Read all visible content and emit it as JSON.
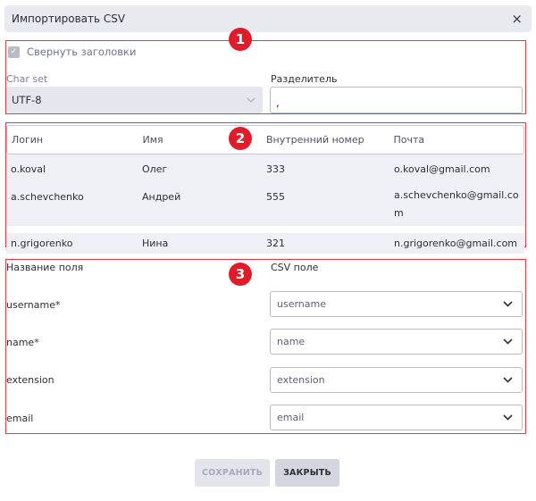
{
  "dialog": {
    "title": "Импортировать CSV",
    "close_glyph": "×"
  },
  "badges": [
    "1",
    "2",
    "3"
  ],
  "settings": {
    "collapse_headers_label": "Свернуть заголовки",
    "collapse_headers_checked": true,
    "charset_label": "Char set",
    "charset_value": "UTF-8",
    "separator_label": "Разделитель",
    "separator_value": ","
  },
  "preview": {
    "headers": [
      "Логин",
      "Имя",
      "Внутренний номер",
      "Почта"
    ],
    "rows": [
      [
        "o.koval",
        "Олег",
        "333",
        "o.koval@gmail.com"
      ],
      [
        "a.schevchenko",
        "Андрей",
        "555",
        "a.schevchenko@gmail.com"
      ],
      [
        "n.grigorenko",
        "Нина",
        "321",
        "n.grigorenko@gmail.com"
      ]
    ]
  },
  "mapping": {
    "field_header": "Название поля",
    "csv_header": "CSV поле",
    "fields": [
      {
        "label": "username*",
        "value": "username"
      },
      {
        "label": "name*",
        "value": "name"
      },
      {
        "label": "extension",
        "value": "extension"
      },
      {
        "label": "email",
        "value": "email"
      }
    ]
  },
  "buttons": {
    "save": "СОХРАНИТЬ",
    "close": "ЗАКРЫТЬ"
  },
  "colors": {
    "highlight": "#e63946",
    "badge": "#e01b2a"
  },
  "icons": {
    "dropdown": "chevron-down-icon",
    "check": "check-icon",
    "close": "close-icon"
  }
}
